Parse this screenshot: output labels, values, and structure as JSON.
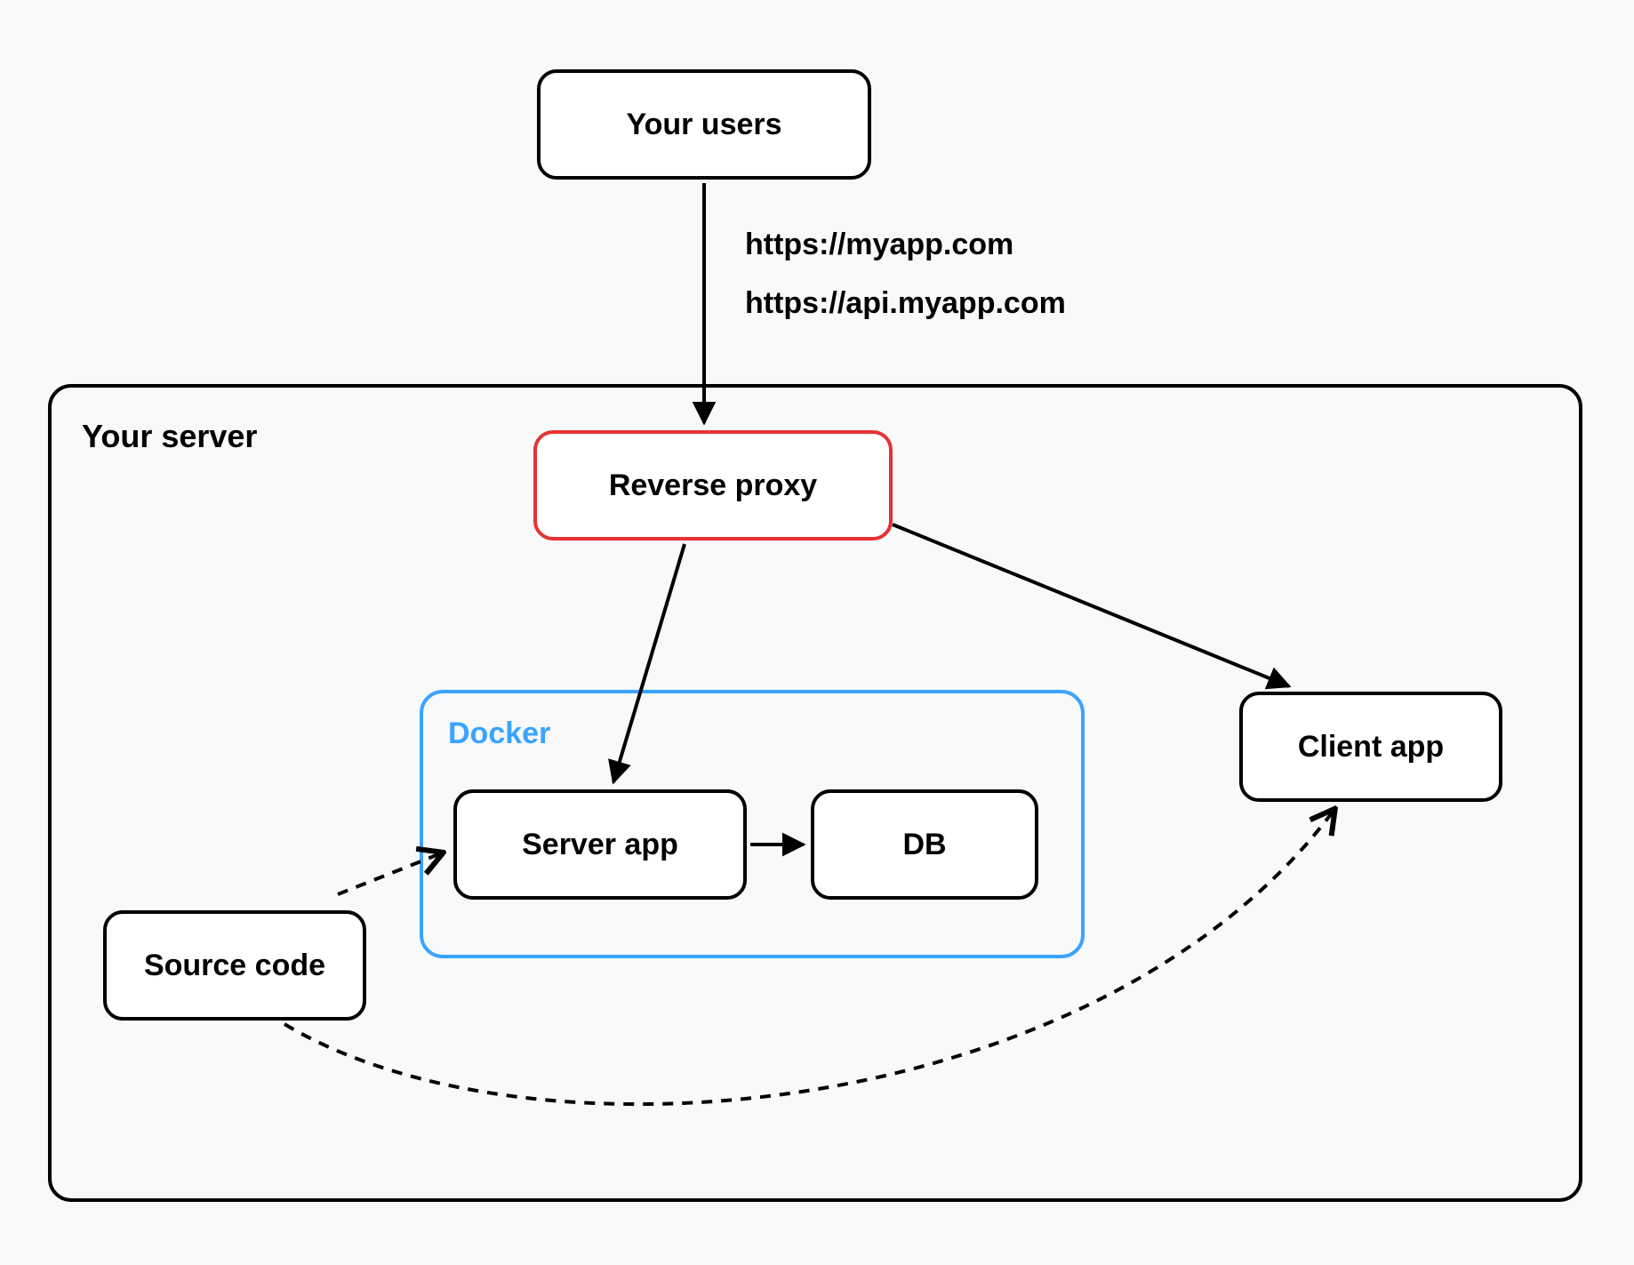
{
  "nodes": {
    "users": "Your users",
    "server_container": "Your server",
    "reverse_proxy": "Reverse proxy",
    "docker_container": "Docker",
    "server_app": "Server app",
    "db": "DB",
    "client_app": "Client app",
    "source_code": "Source code"
  },
  "edges": {
    "users_to_proxy": {
      "labels": [
        "https://myapp.com",
        "https://api.myapp.com"
      ]
    }
  }
}
